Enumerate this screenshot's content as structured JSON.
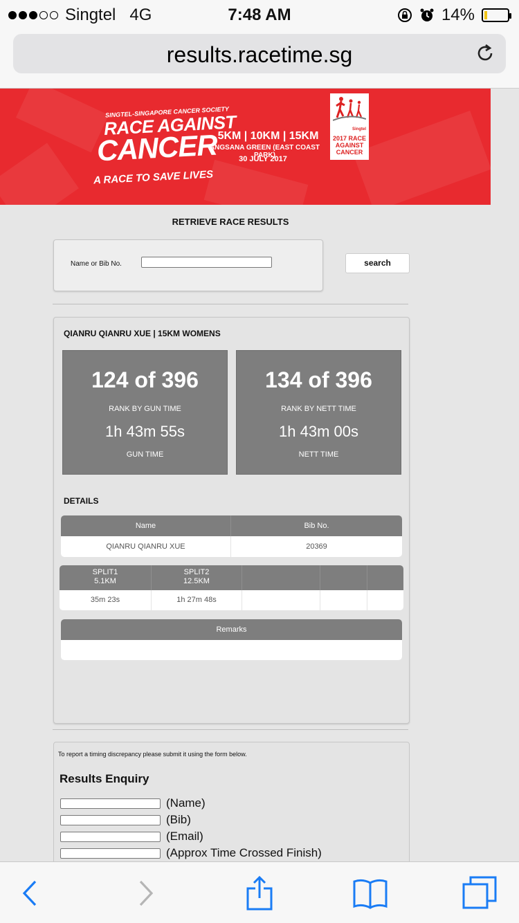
{
  "status_bar": {
    "carrier": "Singtel",
    "network": "4G",
    "time": "7:48 AM",
    "battery": "14%",
    "battery_level": 0.14,
    "signal_bars": 3,
    "icons": [
      "orientation-lock-icon",
      "alarm-icon",
      "battery-icon"
    ]
  },
  "browser": {
    "url": "results.racetime.sg",
    "toolbar": [
      "back-icon",
      "forward-icon",
      "share-icon",
      "bookmarks-icon",
      "tabs-icon"
    ]
  },
  "banner": {
    "society": "SINGTEL-SINGAPORE CANCER SOCIETY",
    "title_line1": "RACE AGAINST",
    "title_line2": "CANCER",
    "tagline": "A RACE TO SAVE LIVES",
    "distances": "5KM | 10KM | 15KM",
    "venue": "ANGSANA GREEN (EAST COAST PARK)",
    "date": "30 JULY 2017",
    "logo_text_small": "Singtel",
    "logo_text": "2017 RACE AGAINST CANCER",
    "colors": {
      "background": "#e82a2f"
    }
  },
  "page": {
    "title": "RETRIEVE RACE RESULTS",
    "search": {
      "label": "Name or Bib No.",
      "value": "",
      "button": "search"
    }
  },
  "result": {
    "runner_title": "QIANRU QIANRU XUE | 15KM WOMENS",
    "gun": {
      "rank": "124 of 396",
      "rank_label": "RANK BY GUN TIME",
      "time": "1h 43m 55s",
      "time_label": "GUN TIME"
    },
    "nett": {
      "rank": "134 of 396",
      "rank_label": "RANK BY NETT TIME",
      "time": "1h 43m 00s",
      "time_label": "NETT TIME"
    },
    "details_heading": "DETAILS",
    "details_table": {
      "headers": [
        "Name",
        "Bib No."
      ],
      "row": [
        "QIANRU QIANRU XUE",
        "20369"
      ]
    },
    "splits_table": {
      "headers": [
        {
          "line1": "SPLIT1",
          "line2": "5.1KM"
        },
        {
          "line1": "SPLIT2",
          "line2": "12.5KM"
        },
        {
          "line1": "",
          "line2": ""
        },
        {
          "line1": "",
          "line2": ""
        },
        {
          "line1": "",
          "line2": ""
        }
      ],
      "row": [
        "35m 23s",
        "1h 27m 48s",
        "",
        "",
        ""
      ]
    },
    "remarks_table": {
      "header": "Remarks",
      "value": ""
    }
  },
  "enquiry": {
    "note": "To report a timing discrepancy please submit it using the form below.",
    "title": "Results Enquiry",
    "fields": [
      {
        "label": "(Name)",
        "value": ""
      },
      {
        "label": "(Bib)",
        "value": ""
      },
      {
        "label": "(Email)",
        "value": ""
      },
      {
        "label": "(Approx Time Crossed Finish)",
        "value": ""
      }
    ]
  }
}
